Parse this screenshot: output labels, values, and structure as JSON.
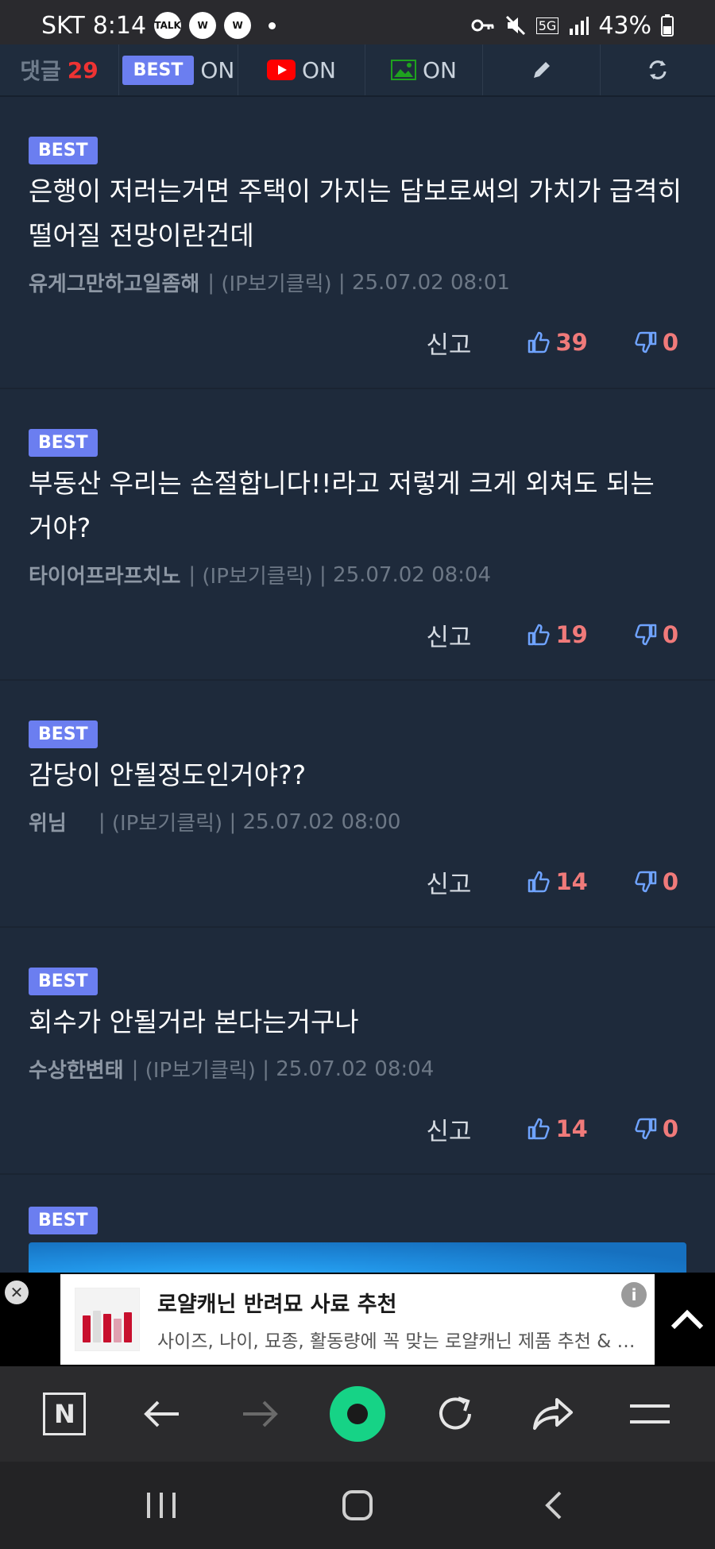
{
  "status_bar": {
    "carrier": "SKT",
    "time": "8:14",
    "badges": [
      "TALK",
      "W",
      "W"
    ],
    "network": "5G",
    "battery": "43%"
  },
  "toolbar": {
    "comment_label": "댓글",
    "comment_count": "29",
    "best_label": "BEST",
    "best_state": "ON",
    "youtube_state": "ON",
    "image_state": "ON"
  },
  "comments": [
    {
      "badge": "BEST",
      "text": "은행이 저러는거면 주택이 가지는 담보로써의 가치가 급격히 떨어질 전망이란건데",
      "author": "유게그만하고일좀해",
      "ip_label": "(IP보기클릭)",
      "timestamp": "25.07.02 08:01",
      "report_label": "신고",
      "likes": "39",
      "dislikes": "0"
    },
    {
      "badge": "BEST",
      "text": "부동산 우리는 손절합니다!!라고 저렇게 크게 외쳐도 되는 거야?",
      "author": "타이어프라프치노",
      "ip_label": "(IP보기클릭)",
      "timestamp": "25.07.02 08:04",
      "report_label": "신고",
      "likes": "19",
      "dislikes": "0"
    },
    {
      "badge": "BEST",
      "text": "감당이 안될정도인거야??",
      "author": "위님",
      "ip_label": "(IP보기클릭)",
      "timestamp": "25.07.02 08:00",
      "report_label": "신고",
      "likes": "14",
      "dislikes": "0"
    },
    {
      "badge": "BEST",
      "text": "회수가 안될거라 본다는거구나",
      "author": "수상한변태",
      "ip_label": "(IP보기클릭)",
      "timestamp": "25.07.02 08:04",
      "report_label": "신고",
      "likes": "14",
      "dislikes": "0"
    },
    {
      "badge": "BEST"
    }
  ],
  "ad": {
    "title": "로얄캐닌 반려묘 사료 추천",
    "description": "사이즈, 나이, 묘종, 활동량에 꼭 맞는 로얄캐닌 제품 추천 & 무..."
  },
  "colors": {
    "background": "#1e2a3b",
    "best_chip": "#6b7ef0",
    "vote_count": "#f07a7a",
    "vote_icon": "#6fa3ff",
    "green_button": "#16d386"
  }
}
